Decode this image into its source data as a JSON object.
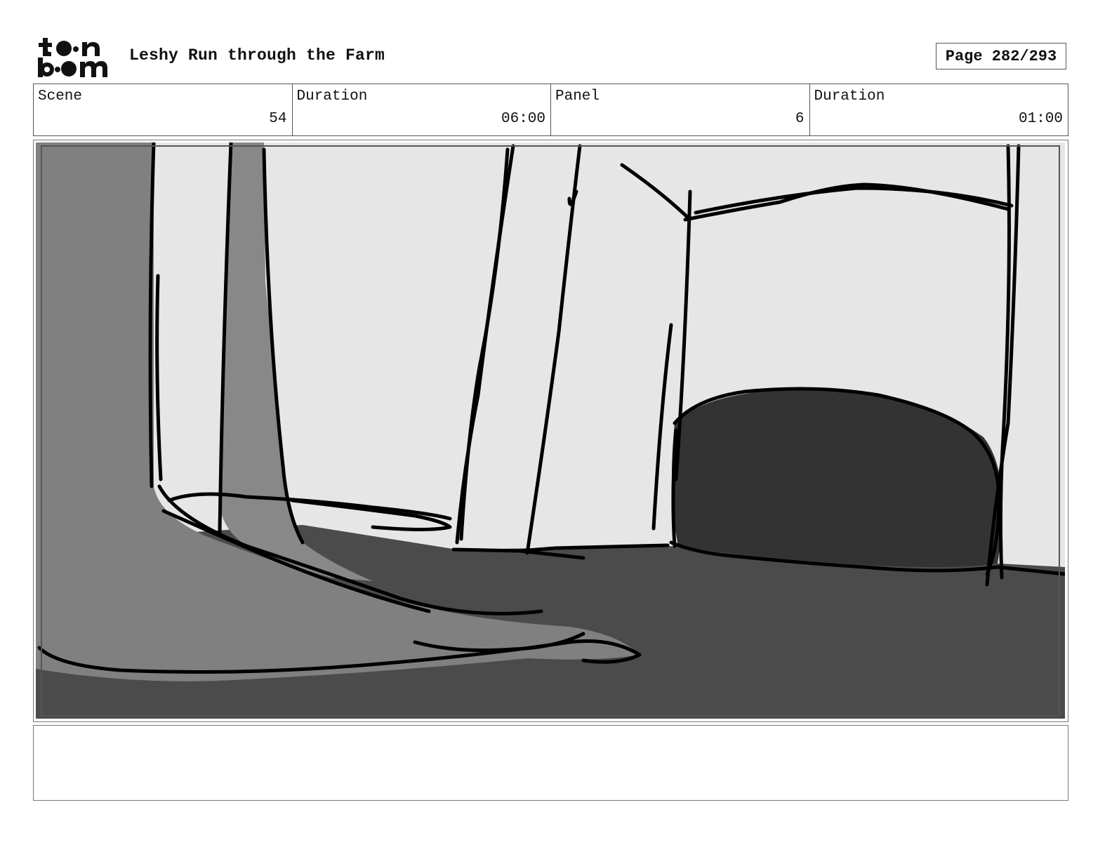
{
  "header": {
    "logo_text": "toonboom",
    "title": "Leshy Run through the Farm",
    "page": "Page 282/293"
  },
  "info": {
    "scene_label": "Scene",
    "scene_value": "54",
    "scene_duration_label": "Duration",
    "scene_duration_value": "06:00",
    "panel_label": "Panel",
    "panel_value": "6",
    "panel_duration_label": "Duration",
    "panel_duration_value": "01:00"
  },
  "notes": {
    "text": ""
  }
}
